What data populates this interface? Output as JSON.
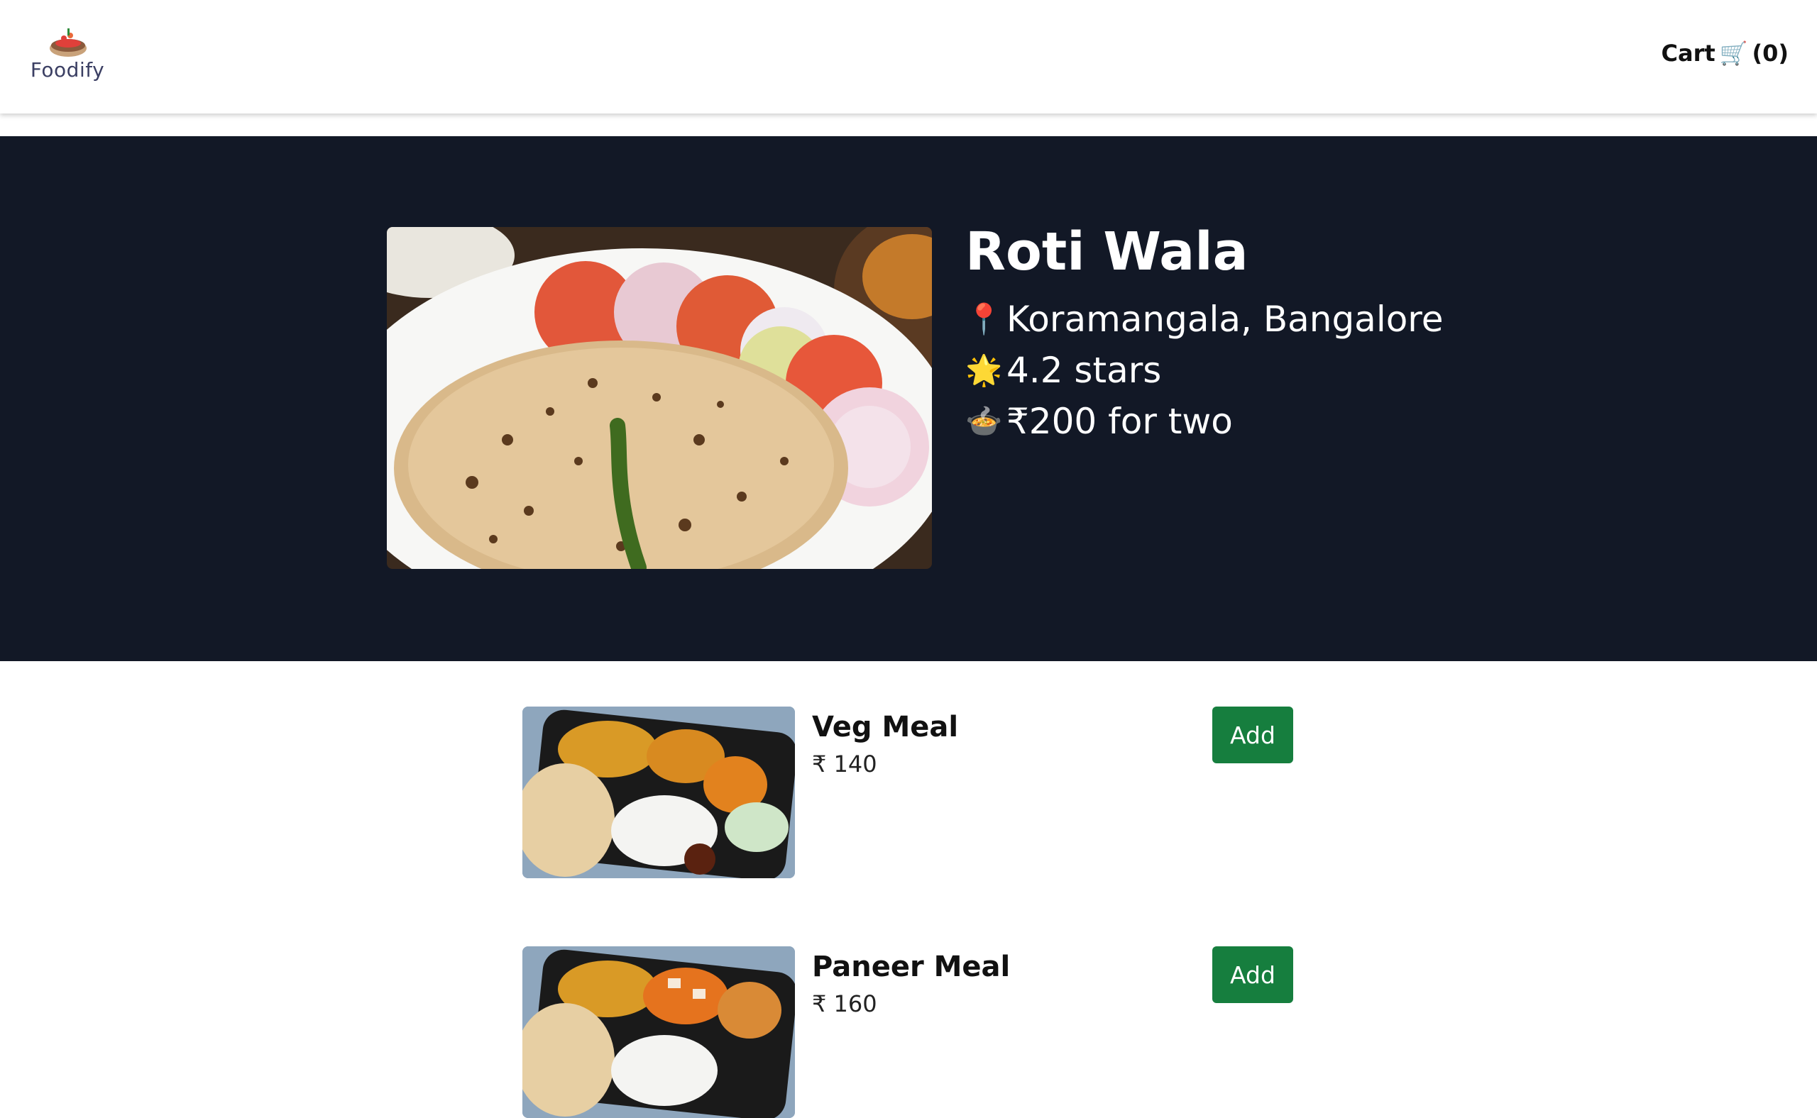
{
  "header": {
    "logo_text": "Foodify",
    "cart_label": "Cart",
    "cart_icon": "🛒",
    "cart_count": "(0)"
  },
  "restaurant": {
    "name": "Roti Wala",
    "location_icon": "📍",
    "location": "Koramangala, Bangalore",
    "rating_icon": "🌟",
    "rating": "4.2 stars",
    "cost_icon": "🍲",
    "cost": "₹200 for two"
  },
  "menu": [
    {
      "name": "Veg Meal",
      "price": "₹ 140",
      "add_label": "Add"
    },
    {
      "name": "Paneer Meal",
      "price": "₹ 160",
      "add_label": "Add"
    }
  ],
  "colors": {
    "hero_bg": "#121826",
    "add_button": "#167e3e",
    "logo_text": "#3b3f63"
  }
}
